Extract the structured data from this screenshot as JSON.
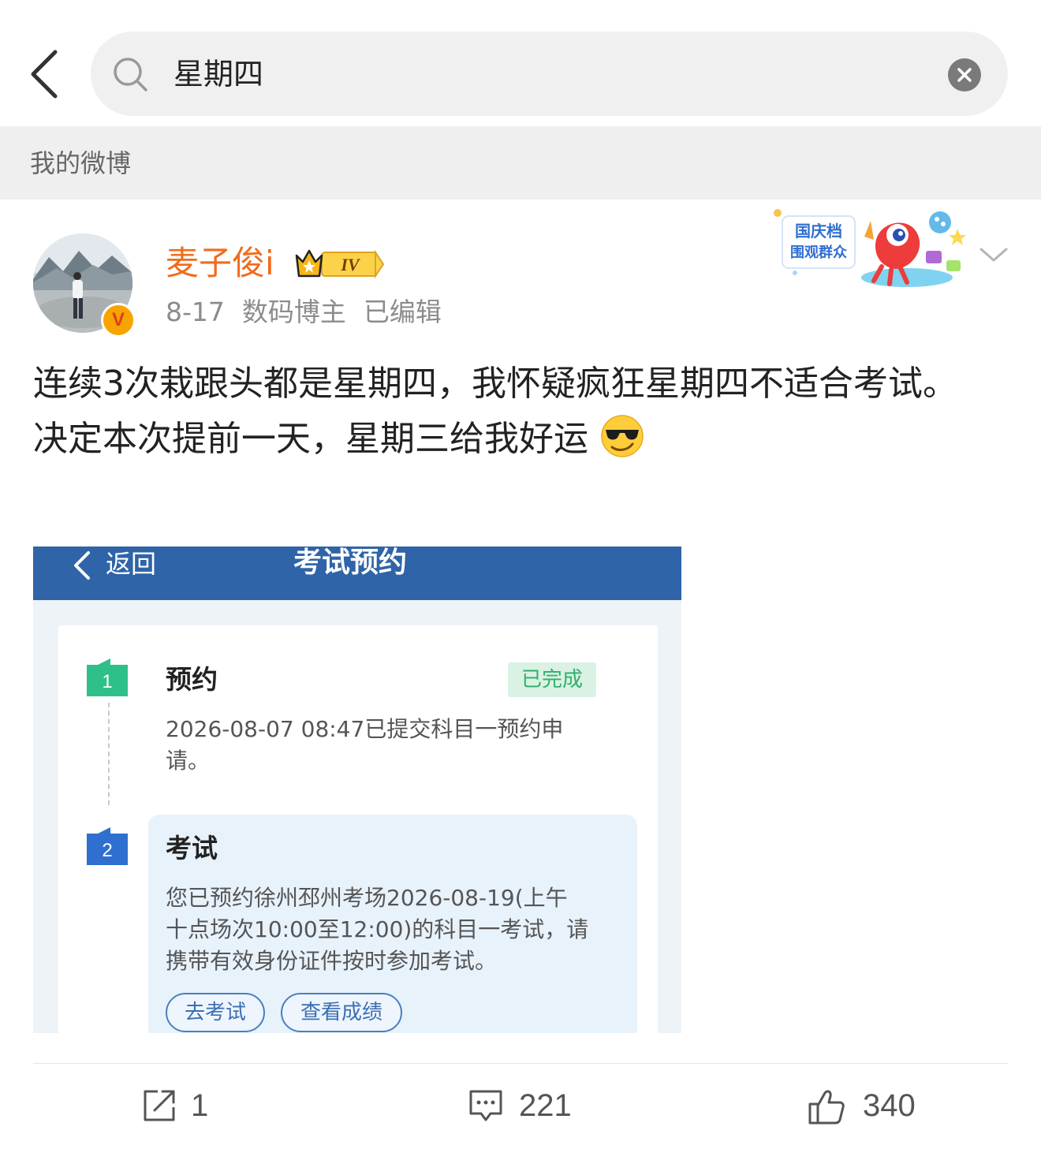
{
  "search": {
    "query": "星期四"
  },
  "section": {
    "title": "我的微博"
  },
  "post": {
    "author": "麦子俊i",
    "vip_level": "IV",
    "verified_mark": "V",
    "date": "8-17",
    "author_tag": "数码博主",
    "edited": "已编辑",
    "text_line1": "连续3次栽跟头都是星期四，我怀疑疯狂星期四不适合考试。",
    "text_line2": "决定本次提前一天，星期三给我好运",
    "sticker_text_1": "国庆档",
    "sticker_text_2": "围观群众"
  },
  "screenshot": {
    "back_label": "返回",
    "title": "考试预约",
    "step1": {
      "number": "1",
      "title": "预约",
      "status": "已完成",
      "desc_line1": "2026-08-07 08:47已提交科目一预约申",
      "desc_line2": "请。"
    },
    "step2": {
      "number": "2",
      "title": "考试",
      "desc_line1": "您已预约徐州邳州考场2026-08-19(上午",
      "desc_line2": "十点场次10:00至12:00)的科目一考试，请",
      "desc_line3": "携带有效身份证件按时参加考试。",
      "button_go": "去考试",
      "button_score": "查看成绩"
    }
  },
  "actions": {
    "repost_count": "1",
    "comment_count": "221",
    "like_count": "340"
  },
  "colors": {
    "username": "#f26b1b",
    "screenshot_header": "#2f64a8",
    "status_green": "#2fb06a"
  }
}
